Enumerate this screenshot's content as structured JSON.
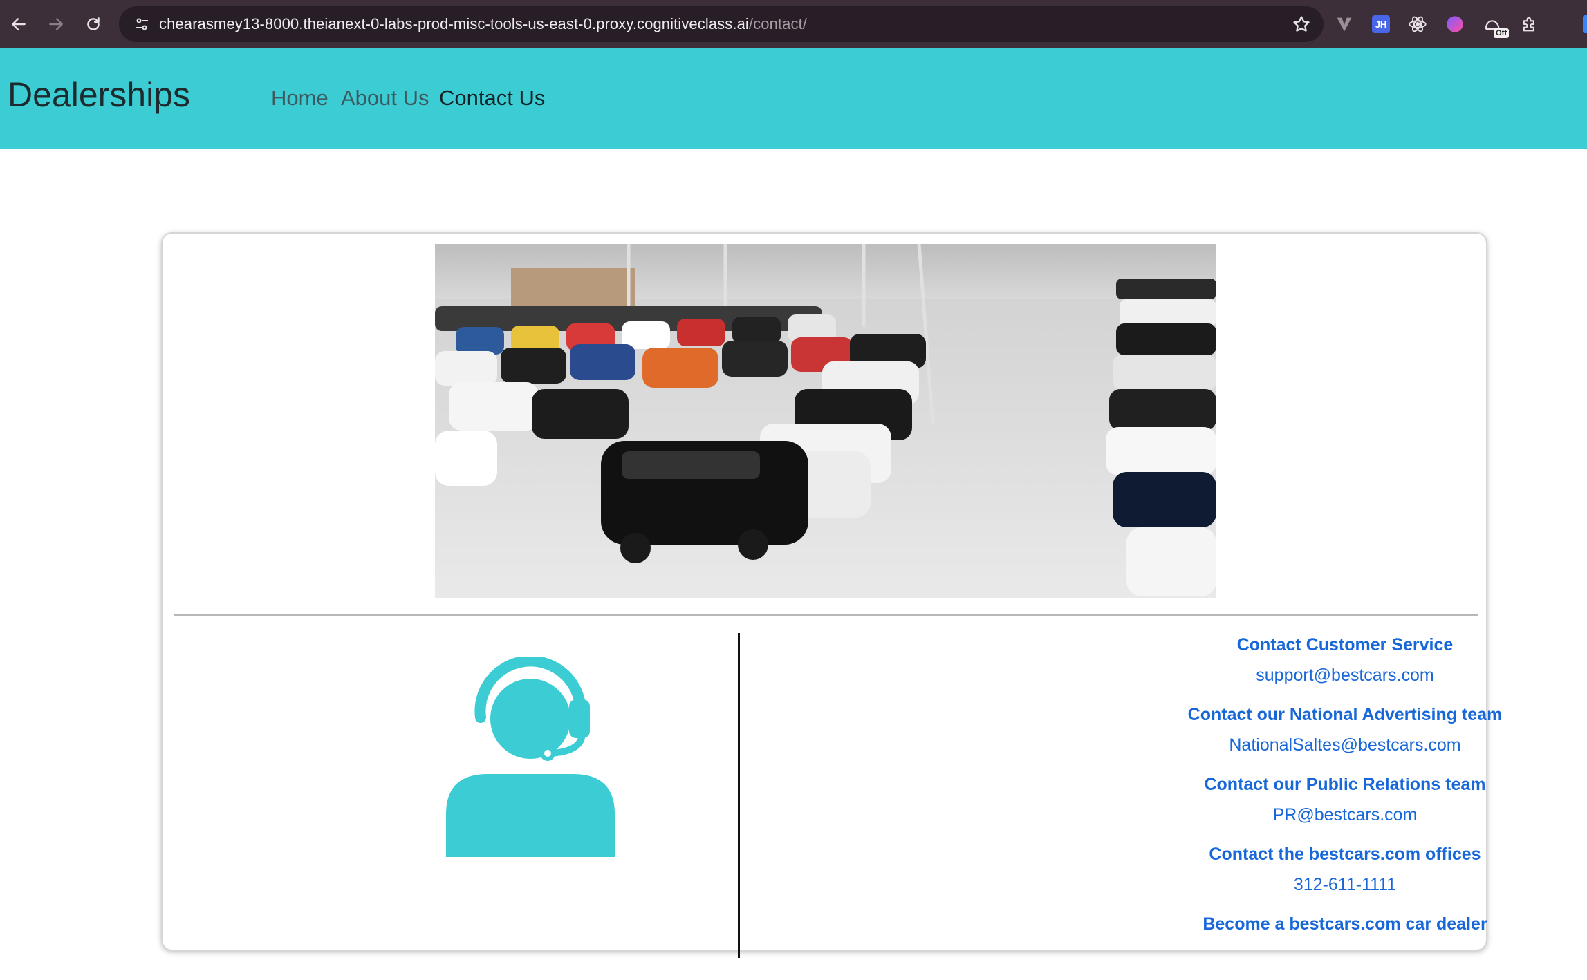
{
  "browser": {
    "url_host": "chearasmey13-8000.theianext-0-labs-prod-misc-tools-us-east-0.proxy.cognitiveclass.ai",
    "url_path": "/contact/",
    "extensions": [
      "vimium-icon",
      "jh-icon",
      "react-devtools-icon",
      "gradient-icon",
      "off-toggle-icon",
      "extensions-puzzle-icon"
    ],
    "ext_jh_label": "JH",
    "ext_off_label": "Off"
  },
  "header": {
    "brand": "Dealerships",
    "nav": [
      "Home",
      "About Us",
      "Contact Us"
    ],
    "active_nav": "Contact Us",
    "background": "#3bcdd3"
  },
  "main": {
    "contacts": [
      {
        "title": "Contact Customer Service",
        "value": "support@bestcars.com"
      },
      {
        "title": "Contact our National Advertising team",
        "value": "NationalSaltes@bestcars.com"
      },
      {
        "title": "Contact our Public Relations team",
        "value": "PR@bestcars.com"
      },
      {
        "title": "Contact the bestcars.com offices",
        "value": "312-611-1111"
      },
      {
        "title": "Become a bestcars.com car dealer",
        "value": ""
      }
    ],
    "link_color": "#1767d8",
    "icon_color": "#3bcdd3"
  }
}
